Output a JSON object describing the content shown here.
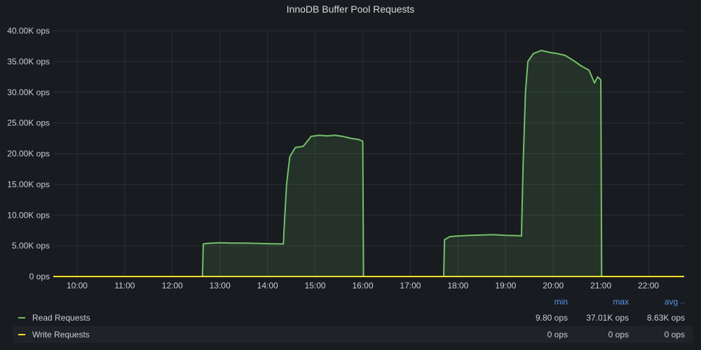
{
  "panel": {
    "title": "InnoDB Buffer Pool Requests"
  },
  "colors": {
    "read": "#73bf69",
    "write": "#fade2a",
    "grid": "#2c2f34",
    "legend_header": "#5794f2"
  },
  "legend": {
    "headers": {
      "min": "min",
      "max": "max",
      "avg": "avg"
    },
    "sort_icon": "chevron-down-icon",
    "series": [
      {
        "name": "Read Requests",
        "color": "#73bf69",
        "min": "9.80 ops",
        "max": "37.01K ops",
        "avg": "8.63K ops"
      },
      {
        "name": "Write Requests",
        "color": "#fade2a",
        "min": "0 ops",
        "max": "0 ops",
        "avg": "0 ops"
      }
    ]
  },
  "chart_data": {
    "type": "area",
    "title": "InnoDB Buffer Pool Requests",
    "x_ticks": [
      "10:00",
      "11:00",
      "12:00",
      "13:00",
      "14:00",
      "15:00",
      "16:00",
      "17:00",
      "18:00",
      "19:00",
      "20:00",
      "21:00",
      "22:00"
    ],
    "y_ticks": [
      "0 ops",
      "5.00K ops",
      "10.00K ops",
      "15.00K ops",
      "20.00K ops",
      "25.00K ops",
      "30.00K ops",
      "35.00K ops",
      "40.00K ops"
    ],
    "xlim": [
      "09:30",
      "22:45"
    ],
    "ylim": [
      0,
      40000
    ],
    "grid": true,
    "series": [
      {
        "name": "Read Requests",
        "color": "#73bf69",
        "fill": true,
        "points": [
          [
            "09:30",
            0
          ],
          [
            "12:38",
            0
          ],
          [
            "12:39",
            5300
          ],
          [
            "12:45",
            5400
          ],
          [
            "13:00",
            5500
          ],
          [
            "13:15",
            5450
          ],
          [
            "13:30",
            5450
          ],
          [
            "13:45",
            5400
          ],
          [
            "14:00",
            5350
          ],
          [
            "14:20",
            5300
          ],
          [
            "14:21",
            8000
          ],
          [
            "14:24",
            15000
          ],
          [
            "14:28",
            19500
          ],
          [
            "14:35",
            21000
          ],
          [
            "14:45",
            21200
          ],
          [
            "14:55",
            22800
          ],
          [
            "15:05",
            23000
          ],
          [
            "15:15",
            22900
          ],
          [
            "15:25",
            23000
          ],
          [
            "15:35",
            22800
          ],
          [
            "15:45",
            22500
          ],
          [
            "15:55",
            22300
          ],
          [
            "16:00",
            22000
          ],
          [
            "16:01",
            0
          ],
          [
            "17:42",
            0
          ],
          [
            "17:43",
            6000
          ],
          [
            "17:50",
            6500
          ],
          [
            "18:00",
            6600
          ],
          [
            "18:15",
            6700
          ],
          [
            "18:30",
            6750
          ],
          [
            "18:45",
            6800
          ],
          [
            "19:00",
            6700
          ],
          [
            "19:15",
            6650
          ],
          [
            "19:20",
            6600
          ],
          [
            "19:22",
            18000
          ],
          [
            "19:25",
            30000
          ],
          [
            "19:28",
            35000
          ],
          [
            "19:35",
            36300
          ],
          [
            "19:45",
            36800
          ],
          [
            "19:55",
            36500
          ],
          [
            "20:05",
            36300
          ],
          [
            "20:15",
            36000
          ],
          [
            "20:25",
            35200
          ],
          [
            "20:35",
            34300
          ],
          [
            "20:45",
            33600
          ],
          [
            "20:52",
            31500
          ],
          [
            "20:56",
            32500
          ],
          [
            "21:00",
            32000
          ],
          [
            "21:01",
            0
          ],
          [
            "22:45",
            0
          ]
        ]
      },
      {
        "name": "Write Requests",
        "color": "#fade2a",
        "fill": false,
        "points": [
          [
            "09:30",
            0
          ],
          [
            "22:45",
            0
          ]
        ]
      }
    ]
  }
}
